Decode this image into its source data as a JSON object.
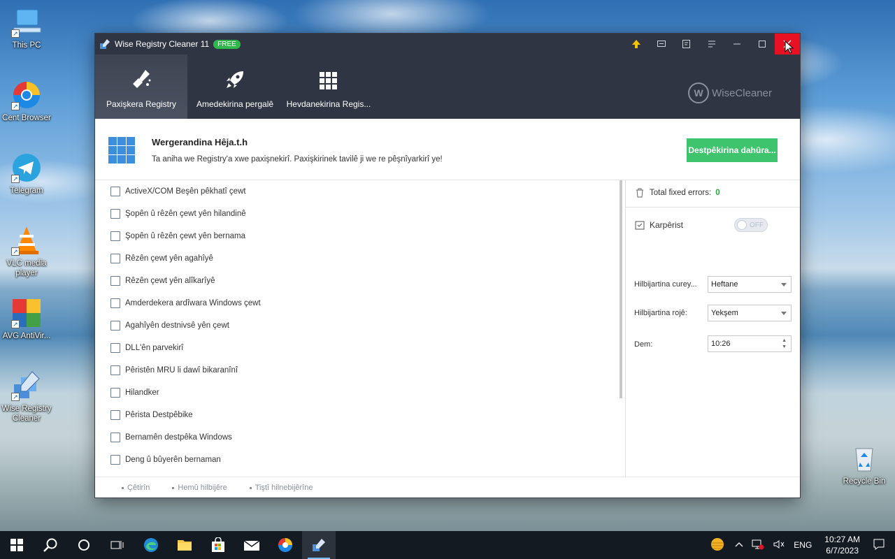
{
  "desktop": {
    "icons": [
      {
        "label": "This PC"
      },
      {
        "label": "Cent Browser"
      },
      {
        "label": "Telegram"
      },
      {
        "label": "VLC media player"
      },
      {
        "label": "AVG AntiVir..."
      },
      {
        "label": "Wise Registry Cleaner"
      },
      {
        "label": "Recycle Bin"
      }
    ]
  },
  "window": {
    "title": "Wise Registry Cleaner 11",
    "badge": "FREE",
    "logo_text": "WiseCleaner",
    "logo_letter": "W",
    "accent": "#3ec46d",
    "titlebar_color": "#2f3542",
    "close_color": "#e81123"
  },
  "toolbar": {
    "tools": [
      {
        "label": "Paxişkera Registry",
        "icon": "broom-icon",
        "active": true
      },
      {
        "label": "Amedekirina pergalê",
        "icon": "rocket-icon",
        "active": false
      },
      {
        "label": "Hevdanekirina Regis...",
        "icon": "grid-icon",
        "active": false
      }
    ]
  },
  "header": {
    "title": "Wergerandina Hêja.t.h",
    "description": "Ta aniha we Registry'a xwe paxişnekirî. Paxişkirinek tavilê ji we re pêşnîyarkirî ye!",
    "start_button": "Destpêkirina dahûra..."
  },
  "list": {
    "items": [
      {
        "label": "ActiveX/COM Beşên pêkhatî çewt",
        "icon": "component-icon"
      },
      {
        "label": "Şopên û rêzên çewt yên hilandinê",
        "icon": "file-search-icon"
      },
      {
        "label": "Şopên û rêzên çewt  yên bernama",
        "icon": "program-icon"
      },
      {
        "label": "Rêzên çewt yên agahîyê",
        "icon": "info-file-icon"
      },
      {
        "label": "Rêzên çewt yên alîkarîyê",
        "icon": "help-file-icon"
      },
      {
        "label": "Amderdekera ardîwara Windows çewt",
        "icon": "window-icon"
      },
      {
        "label": "Agahîyên destnivsê yên çewt",
        "icon": "font-icon"
      },
      {
        "label": "DLL'ên parvekirî",
        "icon": "dll-icon"
      },
      {
        "label": "Pêristên MRU li dawî bikaranînî",
        "icon": "history-icon"
      },
      {
        "label": "Hilandker",
        "icon": "uninstall-icon"
      },
      {
        "label": "Pêrista Destpêbike",
        "icon": "startmenu-icon"
      },
      {
        "label": "Bernamên destpêka Windows",
        "icon": "startup-icon"
      },
      {
        "label": "Deng û bûyerên bernaman",
        "icon": "sound-icon"
      }
    ]
  },
  "side": {
    "total_fixed_label": "Total fixed errors:",
    "total_fixed_value": "0",
    "schedule_label": "Karpêrist",
    "toggle_label": "OFF",
    "frequency_label": "Hilbijartina curey...",
    "frequency_value": "Heftane",
    "day_label": "Hilbijartina rojê:",
    "day_value": "Yekşem",
    "time_label": "Dem:",
    "time_value": "10:26"
  },
  "footer": {
    "links": [
      "Çêtirîn",
      "Hemû hilbijêre",
      "Tiştî hilnebijêrîne"
    ]
  },
  "taskbar": {
    "lang": "ENG",
    "time": "10:27 AM",
    "date": "6/7/2023"
  }
}
